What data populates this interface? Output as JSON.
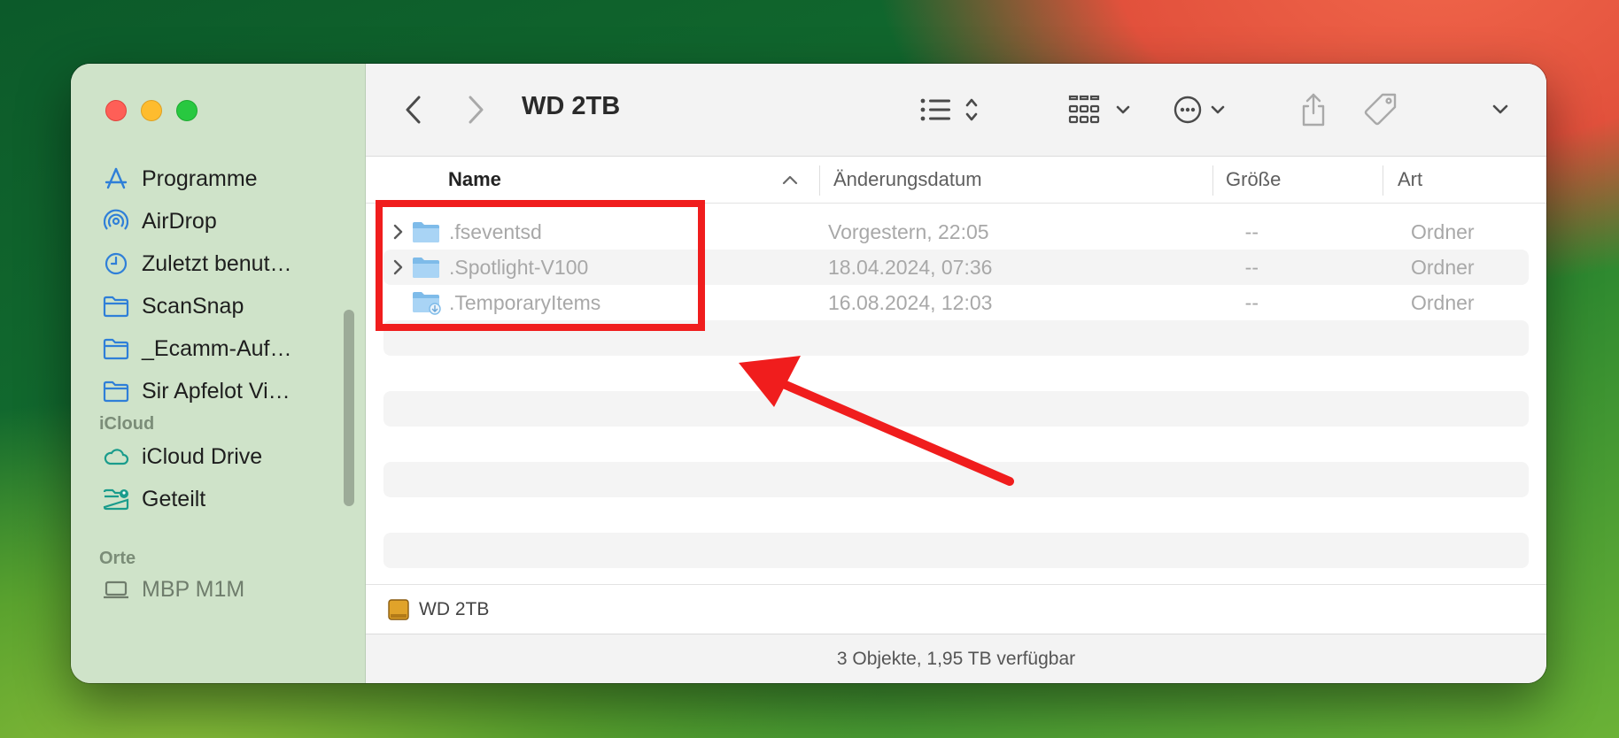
{
  "window": {
    "title": "WD 2TB"
  },
  "sidebar": {
    "items": [
      {
        "label": "Programme",
        "icon": "apps-icon"
      },
      {
        "label": "AirDrop",
        "icon": "airdrop-icon"
      },
      {
        "label": "Zuletzt benut…",
        "icon": "clock-icon"
      },
      {
        "label": "ScanSnap",
        "icon": "folder-icon"
      },
      {
        "label": "_Ecamm-Auf…",
        "icon": "folder-icon"
      },
      {
        "label": "Sir Apfelot Vi…",
        "icon": "folder-icon"
      }
    ],
    "icloud_heading": "iCloud",
    "icloud_items": [
      {
        "label": "iCloud Drive",
        "icon": "cloud-icon"
      },
      {
        "label": "Geteilt",
        "icon": "shared-folder-icon"
      }
    ],
    "places_heading": "Orte",
    "places_items": [
      {
        "label": "MBP M1M",
        "icon": "laptop-icon"
      }
    ]
  },
  "columns": {
    "name": "Name",
    "date": "Änderungsdatum",
    "size": "Größe",
    "kind": "Art"
  },
  "files": [
    {
      "name": ".fseventsd",
      "date": "Vorgestern, 22:05",
      "size": "--",
      "kind": "Ordner",
      "expandable": true
    },
    {
      "name": ".Spotlight-V100",
      "date": "18.04.2024, 07:36",
      "size": "--",
      "kind": "Ordner",
      "expandable": true
    },
    {
      "name": ".TemporaryItems",
      "date": "16.08.2024, 12:03",
      "size": "--",
      "kind": "Ordner",
      "expandable": false
    }
  ],
  "pathbar": {
    "label": "WD 2TB"
  },
  "status": {
    "text": "3 Objekte, 1,95 TB verfügbar"
  },
  "colors": {
    "sidebar_bg": "#cfe3c9",
    "accent_icon": "#2f7fd8",
    "annotation": "#f01d1d",
    "folder": "#8cc4ef"
  }
}
